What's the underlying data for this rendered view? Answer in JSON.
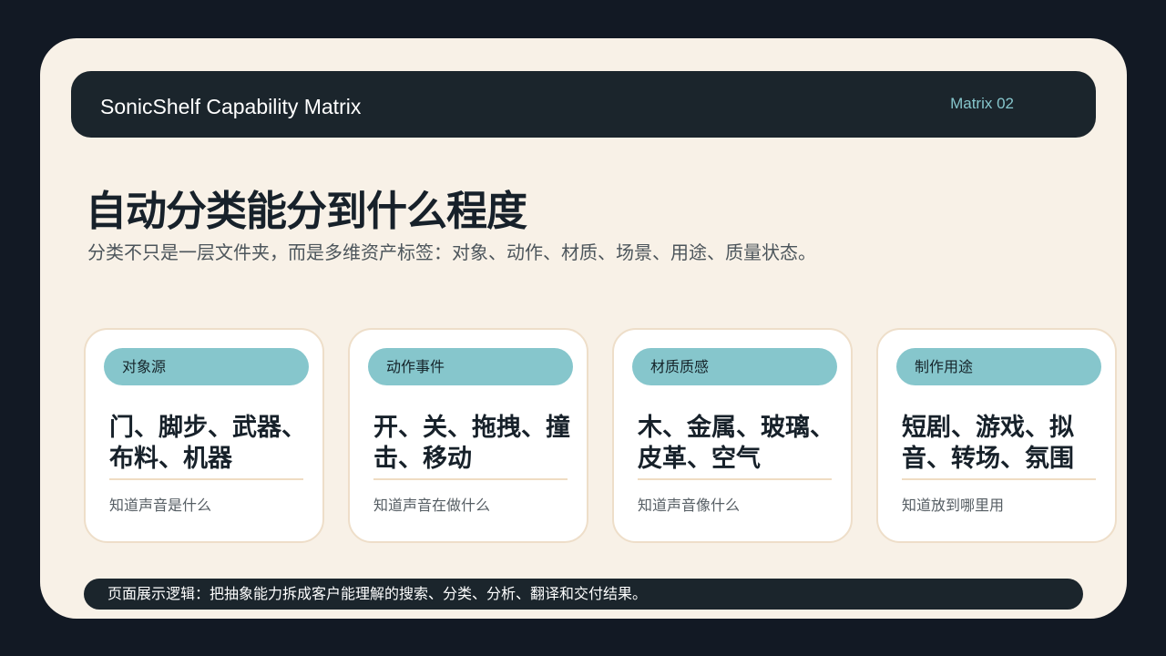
{
  "header": {
    "title": "SonicShelf Capability Matrix",
    "badge": "Matrix 02"
  },
  "main": {
    "title": "自动分类能分到什么程度",
    "subtitle": "分类不只是一层文件夹，而是多维资产标签：对象、动作、材质、场景、用途、质量状态。"
  },
  "cards": [
    {
      "tag": "对象源",
      "heading": "门、脚步、武器、布料、机器",
      "note": "知道声音是什么"
    },
    {
      "tag": "动作事件",
      "heading": "开、关、拖拽、撞击、移动",
      "note": "知道声音在做什么"
    },
    {
      "tag": "材质质感",
      "heading": "木、金属、玻璃、皮革、空气",
      "note": "知道声音像什么"
    },
    {
      "tag": "制作用途",
      "heading": "短剧、游戏、拟音、转场、氛围",
      "note": "知道放到哪里用"
    }
  ],
  "footer": {
    "text": "页面展示逻辑：把抽象能力拆成客户能理解的搜索、分类、分析、翻译和交付结果。"
  },
  "colors": {
    "background": "#121924",
    "slide": "#f8f1e7",
    "dark_bar": "#1b252c",
    "accent_teal": "#86c6cc",
    "card_border": "#eedec9"
  }
}
